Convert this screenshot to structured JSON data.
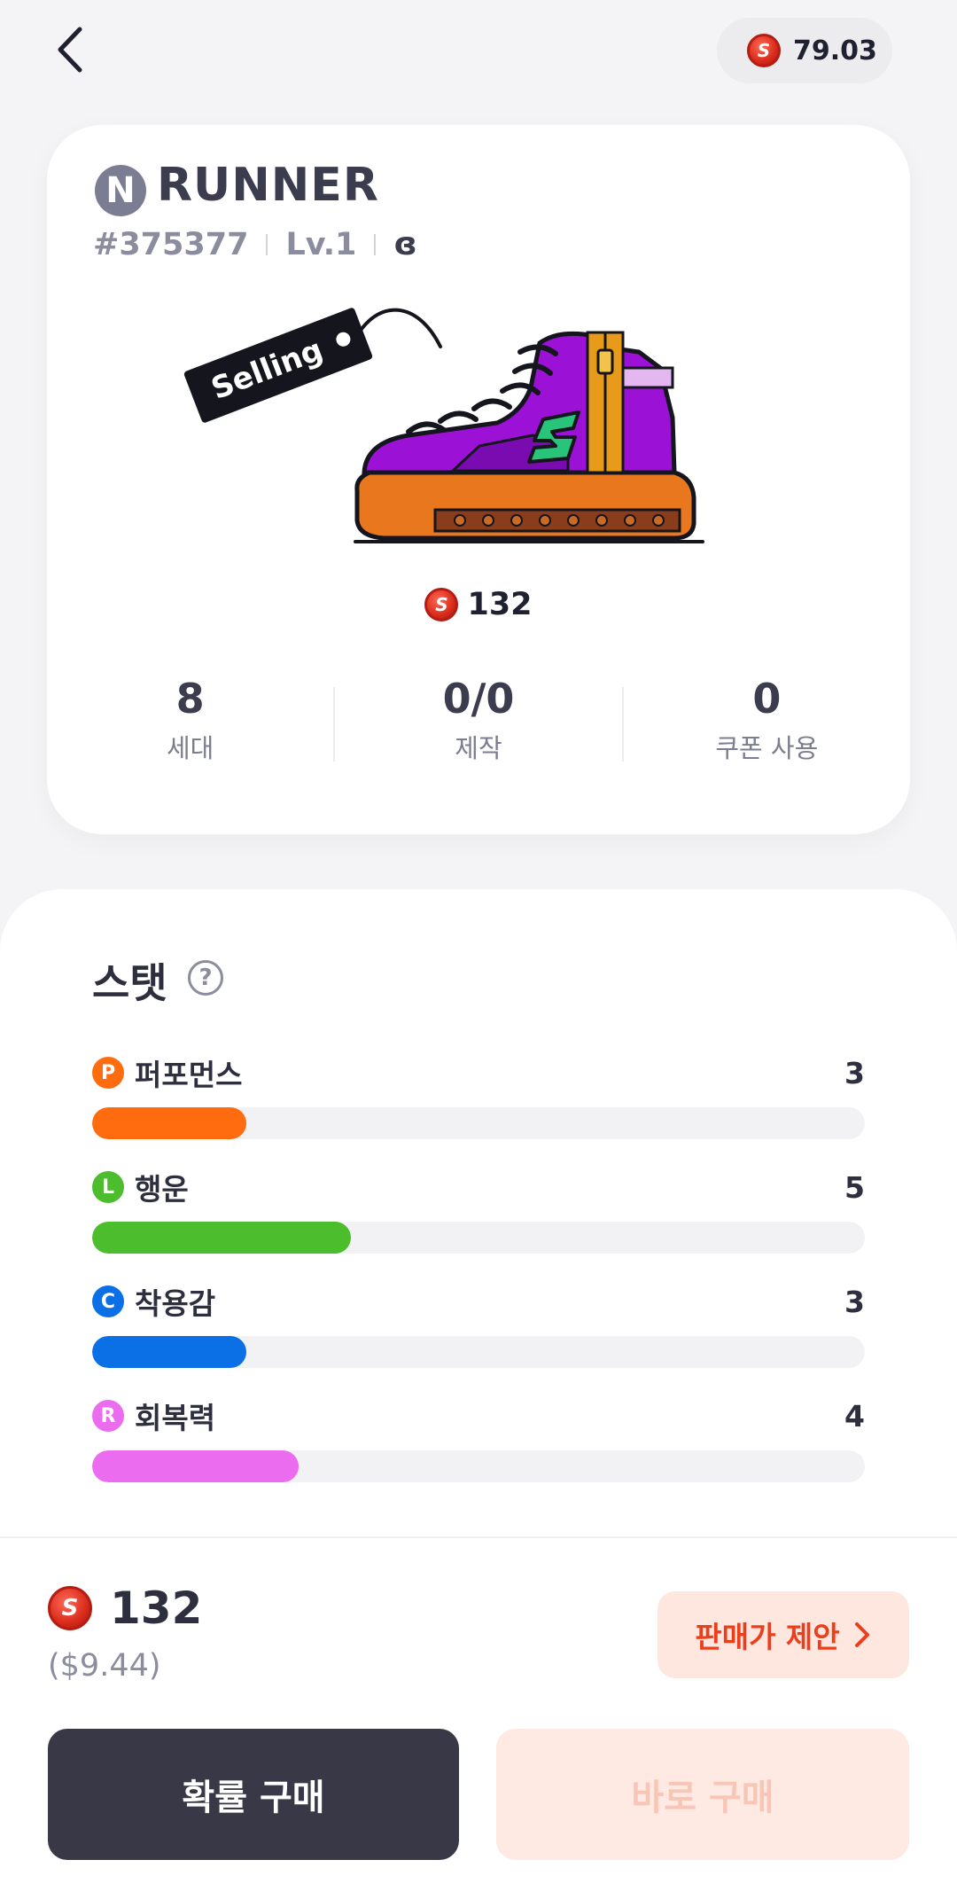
{
  "header": {
    "balance": "79.03"
  },
  "sneaker": {
    "rarity_badge": "N",
    "name": "RUNNER",
    "id": "#375377",
    "level": "Lv.1",
    "gender_symbol": "ɞ",
    "tag_label": "Selling",
    "price": "132",
    "summary": [
      {
        "value": "8",
        "label": "세대"
      },
      {
        "value": "0/0",
        "label": "제작"
      },
      {
        "value": "0",
        "label": "쿠폰 사용"
      }
    ]
  },
  "stats": {
    "title": "스탯",
    "help_glyph": "?",
    "items": [
      {
        "badge": "P",
        "name": "퍼포먼스",
        "value": "3",
        "fill_percent": 20,
        "color": "#ff6b0f"
      },
      {
        "badge": "L",
        "name": "행운",
        "value": "5",
        "fill_percent": 33.5,
        "color": "#4cbd2d"
      },
      {
        "badge": "C",
        "name": "착용감",
        "value": "3",
        "fill_percent": 20,
        "color": "#0b70e6"
      },
      {
        "badge": "R",
        "name": "회복력",
        "value": "4",
        "fill_percent": 26.7,
        "color": "#ec6cf0"
      }
    ]
  },
  "footer": {
    "price": "132",
    "usd": "($9.44)",
    "offer_label": "판매가 제안",
    "probability_buy_label": "확률 구매",
    "direct_buy_label": "바로 구매"
  },
  "colors": {
    "coin": "#d92b1c",
    "accent": "#ea3e1c",
    "dark_button": "#383847"
  }
}
